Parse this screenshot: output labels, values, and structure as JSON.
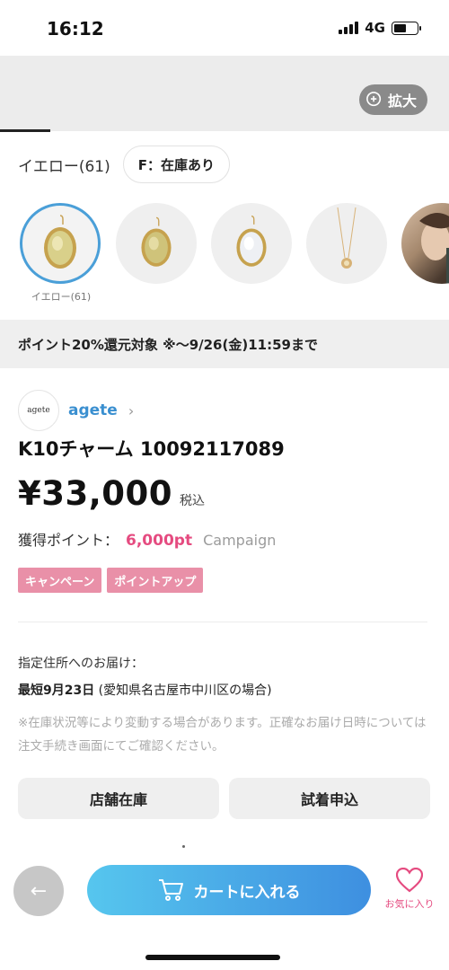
{
  "status_bar": {
    "time": "16:12",
    "network": "4G",
    "battery_level": 0.55
  },
  "hero": {
    "zoom_label": "拡大"
  },
  "variant": {
    "color_label": "イエロー(61)",
    "stock_filter": "F：在庫あり"
  },
  "thumbnails": [
    {
      "caption": "イエロー(61)",
      "selected": true,
      "icon": "yellow-stone-pendant"
    },
    {
      "caption": "",
      "selected": false,
      "icon": "yellow-stone-pendant"
    },
    {
      "caption": "",
      "selected": false,
      "icon": "clear-stone-pendant"
    },
    {
      "caption": "",
      "selected": false,
      "icon": "necklace"
    },
    {
      "caption": "",
      "selected": false,
      "icon": "model-photo"
    }
  ],
  "promo": {
    "text": "ポイント20%還元対象 ※～9/26(金)11:59まで"
  },
  "brand": {
    "logo_text": "agete",
    "name": "agete",
    "chevron": "›"
  },
  "product": {
    "title": "K10チャーム 10092117089",
    "price": "¥33,000",
    "tax_label": "税込",
    "points_label": "獲得ポイント：",
    "points_value": "6,000pt",
    "campaign_label": "Campaign",
    "tags": [
      "キャンペーン",
      "ポイントアップ"
    ]
  },
  "delivery": {
    "label": "指定住所へのお届け：",
    "date_bold": "最短9月23日",
    "date_rest": " (愛知県名古屋市中川区の場合)",
    "note": "※在庫状況等により変動する場合があります。正確なお届け日時については注文手続き画面にてご確認ください。"
  },
  "actions": {
    "store_stock": "店舗在庫",
    "try_on": "試着申込"
  },
  "bottom_bar": {
    "back_icon": "←",
    "cart_label": "カートに入れる",
    "favorite_label": "お気に入り"
  },
  "colors": {
    "accent_blue": "#3e8fe0",
    "pink": "#e54b80",
    "tag_pink": "#e990a8",
    "selected_ring": "#4a9fd8"
  }
}
